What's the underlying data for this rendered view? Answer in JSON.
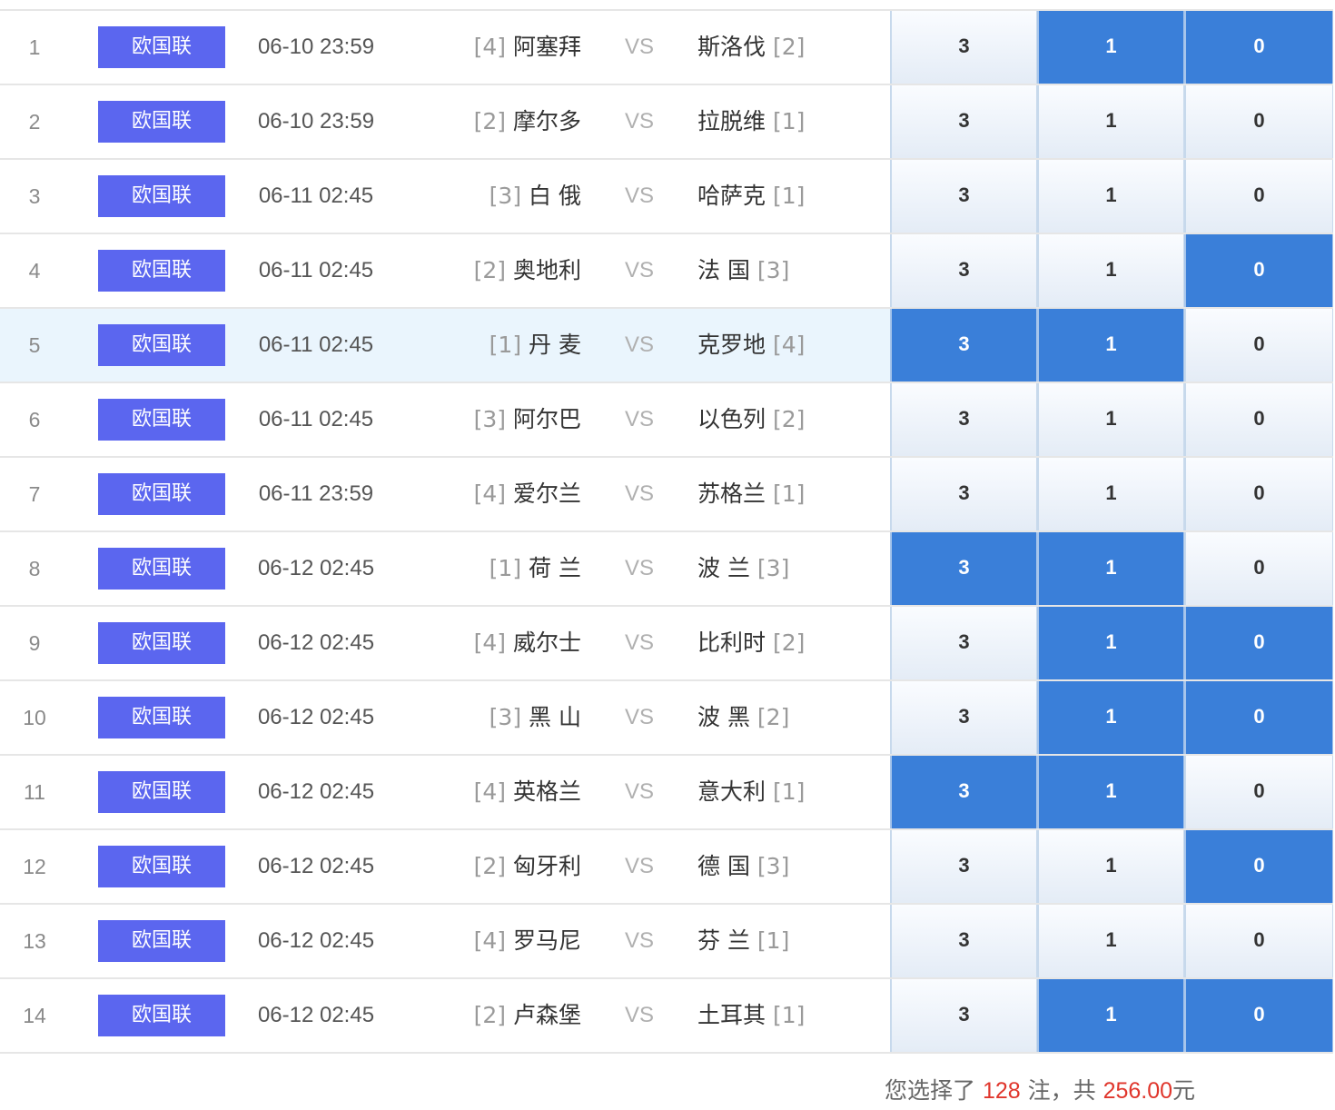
{
  "matches": [
    {
      "no": "1",
      "league": "欧国联",
      "time": "06-10 23:59",
      "home_rank": "[4]",
      "home": "阿塞拜",
      "vs": "VS",
      "away": "斯洛伐",
      "away_rank": "[2]",
      "highlight": false,
      "picks": [
        {
          "label": "3",
          "selected": false
        },
        {
          "label": "1",
          "selected": true
        },
        {
          "label": "0",
          "selected": true
        }
      ]
    },
    {
      "no": "2",
      "league": "欧国联",
      "time": "06-10 23:59",
      "home_rank": "[2]",
      "home": "摩尔多",
      "vs": "VS",
      "away": "拉脱维",
      "away_rank": "[1]",
      "highlight": false,
      "picks": [
        {
          "label": "3",
          "selected": false
        },
        {
          "label": "1",
          "selected": false
        },
        {
          "label": "0",
          "selected": false
        }
      ]
    },
    {
      "no": "3",
      "league": "欧国联",
      "time": "06-11 02:45",
      "home_rank": "[3]",
      "home": "白 俄",
      "vs": "VS",
      "away": "哈萨克",
      "away_rank": "[1]",
      "highlight": false,
      "picks": [
        {
          "label": "3",
          "selected": false
        },
        {
          "label": "1",
          "selected": false
        },
        {
          "label": "0",
          "selected": false
        }
      ]
    },
    {
      "no": "4",
      "league": "欧国联",
      "time": "06-11 02:45",
      "home_rank": "[2]",
      "home": "奥地利",
      "vs": "VS",
      "away": "法 国",
      "away_rank": "[3]",
      "highlight": false,
      "picks": [
        {
          "label": "3",
          "selected": false
        },
        {
          "label": "1",
          "selected": false
        },
        {
          "label": "0",
          "selected": true
        }
      ]
    },
    {
      "no": "5",
      "league": "欧国联",
      "time": "06-11 02:45",
      "home_rank": "[1]",
      "home": "丹 麦",
      "vs": "VS",
      "away": "克罗地",
      "away_rank": "[4]",
      "highlight": true,
      "picks": [
        {
          "label": "3",
          "selected": true
        },
        {
          "label": "1",
          "selected": true
        },
        {
          "label": "0",
          "selected": false
        }
      ]
    },
    {
      "no": "6",
      "league": "欧国联",
      "time": "06-11 02:45",
      "home_rank": "[3]",
      "home": "阿尔巴",
      "vs": "VS",
      "away": "以色列",
      "away_rank": "[2]",
      "highlight": false,
      "picks": [
        {
          "label": "3",
          "selected": false
        },
        {
          "label": "1",
          "selected": false
        },
        {
          "label": "0",
          "selected": false
        }
      ]
    },
    {
      "no": "7",
      "league": "欧国联",
      "time": "06-11 23:59",
      "home_rank": "[4]",
      "home": "爱尔兰",
      "vs": "VS",
      "away": "苏格兰",
      "away_rank": "[1]",
      "highlight": false,
      "picks": [
        {
          "label": "3",
          "selected": false
        },
        {
          "label": "1",
          "selected": false
        },
        {
          "label": "0",
          "selected": false
        }
      ]
    },
    {
      "no": "8",
      "league": "欧国联",
      "time": "06-12 02:45",
      "home_rank": "[1]",
      "home": "荷 兰",
      "vs": "VS",
      "away": "波 兰",
      "away_rank": "[3]",
      "highlight": false,
      "picks": [
        {
          "label": "3",
          "selected": true
        },
        {
          "label": "1",
          "selected": true
        },
        {
          "label": "0",
          "selected": false
        }
      ]
    },
    {
      "no": "9",
      "league": "欧国联",
      "time": "06-12 02:45",
      "home_rank": "[4]",
      "home": "威尔士",
      "vs": "VS",
      "away": "比利时",
      "away_rank": "[2]",
      "highlight": false,
      "picks": [
        {
          "label": "3",
          "selected": false
        },
        {
          "label": "1",
          "selected": true
        },
        {
          "label": "0",
          "selected": true
        }
      ]
    },
    {
      "no": "10",
      "league": "欧国联",
      "time": "06-12 02:45",
      "home_rank": "[3]",
      "home": "黑 山",
      "vs": "VS",
      "away": "波 黑",
      "away_rank": "[2]",
      "highlight": false,
      "picks": [
        {
          "label": "3",
          "selected": false
        },
        {
          "label": "1",
          "selected": true
        },
        {
          "label": "0",
          "selected": true
        }
      ]
    },
    {
      "no": "11",
      "league": "欧国联",
      "time": "06-12 02:45",
      "home_rank": "[4]",
      "home": "英格兰",
      "vs": "VS",
      "away": "意大利",
      "away_rank": "[1]",
      "highlight": false,
      "picks": [
        {
          "label": "3",
          "selected": true
        },
        {
          "label": "1",
          "selected": true
        },
        {
          "label": "0",
          "selected": false
        }
      ]
    },
    {
      "no": "12",
      "league": "欧国联",
      "time": "06-12 02:45",
      "home_rank": "[2]",
      "home": "匈牙利",
      "vs": "VS",
      "away": "德 国",
      "away_rank": "[3]",
      "highlight": false,
      "picks": [
        {
          "label": "3",
          "selected": false
        },
        {
          "label": "1",
          "selected": false
        },
        {
          "label": "0",
          "selected": true
        }
      ]
    },
    {
      "no": "13",
      "league": "欧国联",
      "time": "06-12 02:45",
      "home_rank": "[4]",
      "home": "罗马尼",
      "vs": "VS",
      "away": "芬 兰",
      "away_rank": "[1]",
      "highlight": false,
      "picks": [
        {
          "label": "3",
          "selected": false
        },
        {
          "label": "1",
          "selected": false
        },
        {
          "label": "0",
          "selected": false
        }
      ]
    },
    {
      "no": "14",
      "league": "欧国联",
      "time": "06-12 02:45",
      "home_rank": "[2]",
      "home": "卢森堡",
      "vs": "VS",
      "away": "土耳其",
      "away_rank": "[1]",
      "highlight": false,
      "picks": [
        {
          "label": "3",
          "selected": false
        },
        {
          "label": "1",
          "selected": true
        },
        {
          "label": "0",
          "selected": true
        }
      ]
    }
  ],
  "summary": {
    "prefix": "您选择了 ",
    "bets": "128",
    "middle": " 注，共 ",
    "amount": "256.00",
    "suffix": "元"
  },
  "colors": {
    "league_badge": "#5b66ef",
    "selected_option": "#3a7fd9",
    "highlight_row": "#eaf5fd",
    "summary_accent": "#e0362c"
  }
}
